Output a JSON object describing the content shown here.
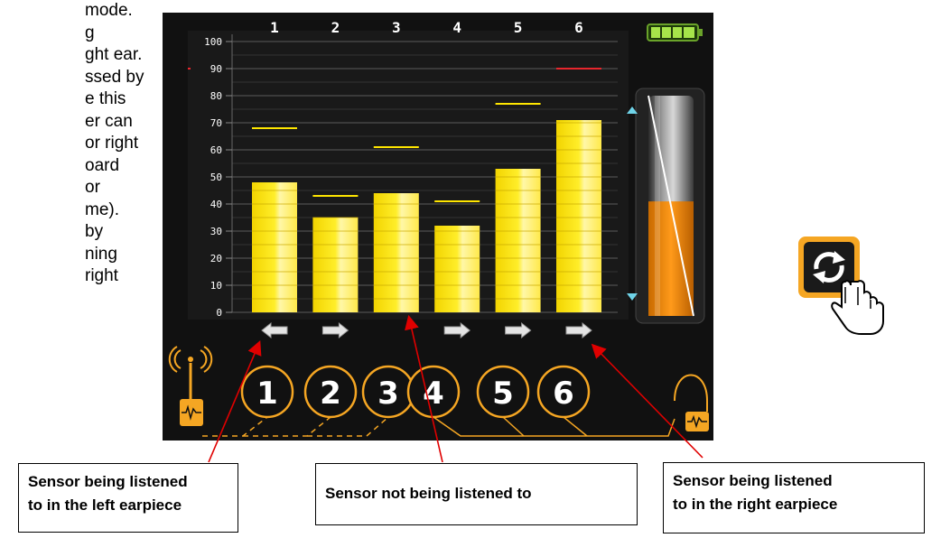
{
  "side_text_lines": [
    "mode.",
    "g",
    "ght ear.",
    "ssed by",
    "e this",
    "er can",
    "or right",
    "oard",
    "or",
    "me).",
    "by",
    "ning",
    "right"
  ],
  "chart_data": {
    "type": "bar",
    "title": "",
    "categories": [
      "1",
      "2",
      "3",
      "4",
      "5",
      "6"
    ],
    "values": [
      48,
      35,
      44,
      32,
      53,
      71
    ],
    "markers": [
      68,
      43,
      61,
      41,
      77,
      90
    ],
    "marker_colors": [
      "#ffe600",
      "#ffe600",
      "#ffe600",
      "#ffe600",
      "#ffe600",
      "#e8262d"
    ],
    "ylim": [
      0,
      100
    ],
    "yticks": [
      0,
      10,
      20,
      30,
      40,
      50,
      60,
      70,
      80,
      90,
      100
    ],
    "grid": true
  },
  "ear_arrows": [
    "left-arrow-icon",
    "right-arrow-icon",
    "",
    "right-arrow-icon",
    "right-arrow-icon",
    "right-arrow-icon"
  ],
  "sensor_buttons": [
    "1",
    "2",
    "3",
    "4",
    "5",
    "6"
  ],
  "volume_level": 0.52,
  "battery_icon": "battery-full-icon",
  "wireless_icon": "wireless-transmitter-icon",
  "wired_icon": "wired-transmitter-icon",
  "refresh_icon": "refresh-icon",
  "pointer_icon": "hand-pointer-icon",
  "colors": {
    "bar": "#ffe600",
    "accent": "#f5a623",
    "screen_bg": "#111111",
    "volume": "#f7941d",
    "annotation": "#e00000"
  },
  "callouts": {
    "left": [
      "Sensor being listened",
      "to in the left earpiece"
    ],
    "middle": "Sensor not being listened to",
    "right": [
      "Sensor being listened",
      "to in the right earpiece"
    ]
  }
}
